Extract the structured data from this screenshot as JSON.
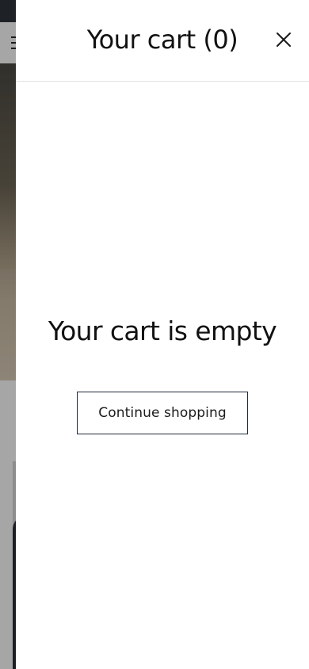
{
  "cart": {
    "title": "Your cart (0)",
    "empty_message": "Your cart is empty",
    "continue_label": "Continue shopping",
    "close_icon": "close-icon"
  },
  "colors": {
    "drawer_background": "#ffffff",
    "text": "#111111",
    "button_border": "#1e2a3a",
    "overlay": "rgba(0,0,0,0.35)"
  }
}
